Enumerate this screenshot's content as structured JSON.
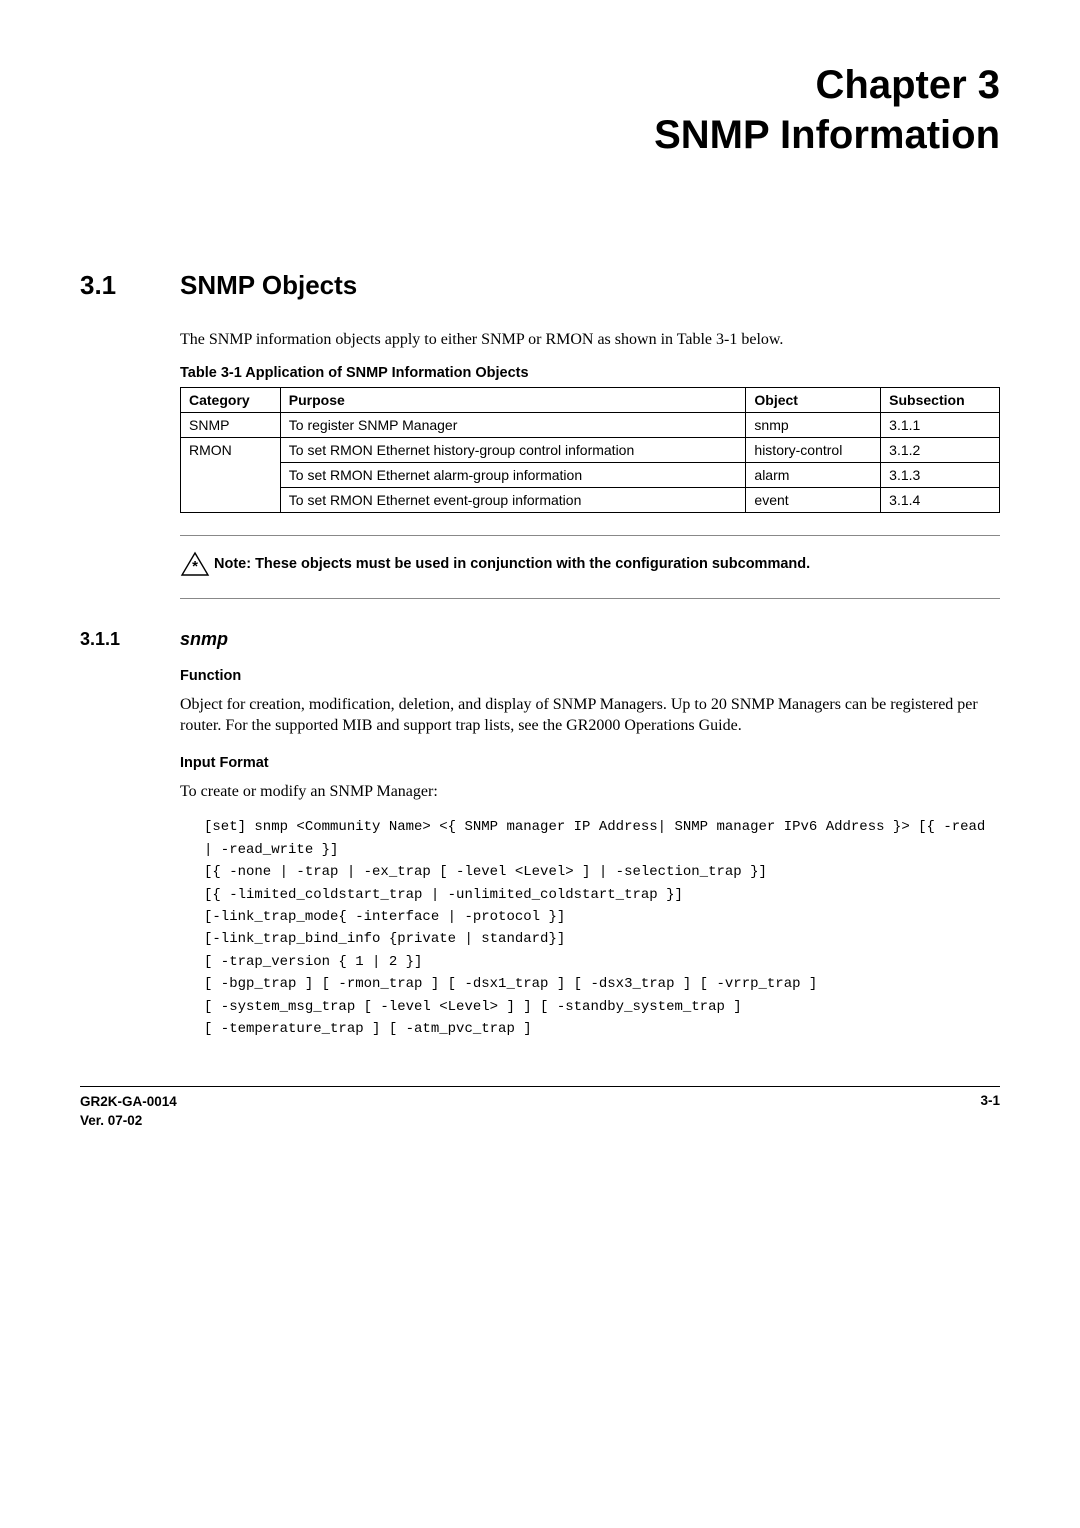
{
  "chapter": {
    "line1": "Chapter 3",
    "line2": "SNMP Information"
  },
  "section": {
    "number": "3.1",
    "title": "SNMP Objects",
    "intro": "The SNMP information objects apply to either SNMP or RMON as shown in Table 3-1 below."
  },
  "table": {
    "caption": "Table 3-1    Application of SNMP Information Objects",
    "headers": {
      "category": "Category",
      "purpose": "Purpose",
      "object": "Object",
      "subsection": "Subsection"
    },
    "rows": [
      {
        "category": "SNMP",
        "purpose": "To register SNMP Manager",
        "object": "snmp",
        "subsection": "3.1.1"
      },
      {
        "category": "RMON",
        "purpose": "To set RMON Ethernet history-group control information",
        "object": "history-control",
        "subsection": "3.1.2"
      },
      {
        "category": "",
        "purpose": "To set RMON Ethernet alarm-group information",
        "object": "alarm",
        "subsection": "3.1.3"
      },
      {
        "category": "",
        "purpose": "To set RMON Ethernet event-group information",
        "object": "event",
        "subsection": "3.1.4"
      }
    ]
  },
  "note": "Note:  These objects must be used in conjunction with the configuration subcommand.",
  "subsection": {
    "number": "3.1.1",
    "title": "snmp",
    "function_head": "Function",
    "function_body": "Object for creation, modification, deletion, and display of SNMP Managers. Up to 20 SNMP Managers can be registered per router. For the supported MIB and support trap lists, see the GR2000 Operations Guide.",
    "input_head": "Input Format",
    "input_intro": "To create or modify an SNMP Manager:",
    "code": "[set] snmp <Community Name> <{ SNMP manager IP Address| SNMP manager IPv6 Address }> [{ -read | -read_write }]\n[{ -none | -trap | -ex_trap [ -level <Level> ] | -selection_trap }]\n[{ -limited_coldstart_trap | -unlimited_coldstart_trap }]\n[-link_trap_mode{ -interface | -protocol }]\n[-link_trap_bind_info {private | standard}]\n[ -trap_version { 1 | 2 }]\n[ -bgp_trap ] [ -rmon_trap ] [ -dsx1_trap ] [ -dsx3_trap ] [ -vrrp_trap ]\n[ -system_msg_trap [ -level <Level> ] ] [ -standby_system_trap ]\n[ -temperature_trap ] [ -atm_pvc_trap ]"
  },
  "footer": {
    "docnum": "GR2K-GA-0014",
    "version": "Ver. 07-02",
    "page": "3-1"
  }
}
